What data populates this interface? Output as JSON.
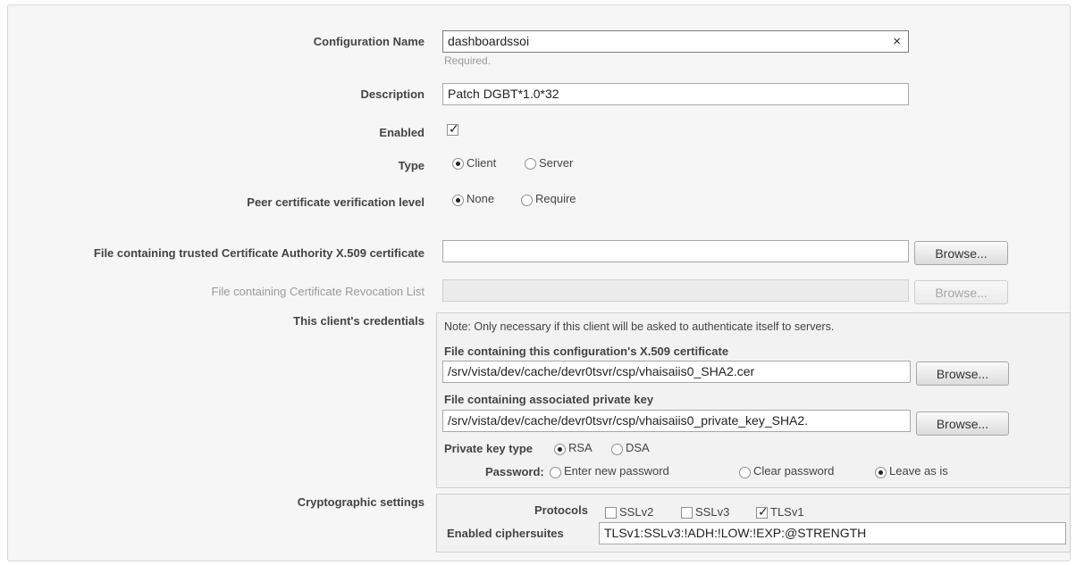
{
  "config_name": {
    "label": "Configuration Name",
    "value": "dashboardssoi",
    "hint": "Required.",
    "clear_icon": "×"
  },
  "description": {
    "label": "Description",
    "value": "Patch DGBT*1.0*32"
  },
  "enabled": {
    "label": "Enabled",
    "checked": true,
    "check_glyph": "✓"
  },
  "type": {
    "label": "Type",
    "options": [
      "Client",
      "Server"
    ],
    "selected": "Client"
  },
  "peer_verification": {
    "label": "Peer certificate verification level",
    "options": [
      "None",
      "Require"
    ],
    "selected": "None"
  },
  "trusted_ca": {
    "label": "File containing trusted Certificate Authority X.509 certificate",
    "value": "",
    "browse": "Browse..."
  },
  "crl": {
    "label": "File containing Certificate Revocation List",
    "value": "",
    "browse": "Browse..."
  },
  "credentials": {
    "label": "This client's credentials",
    "note": "Note: Only necessary if this client will be asked to authenticate itself to servers.",
    "cert_label": "File containing this configuration's X.509 certificate",
    "cert_value": "/srv/vista/dev/cache/devr0tsvr/csp/vhaisaiis0_SHA2.cer",
    "key_label": "File containing associated private key",
    "key_value": "/srv/vista/dev/cache/devr0tsvr/csp/vhaisaiis0_private_key_SHA2.",
    "browse": "Browse...",
    "key_type_label": "Private key type",
    "key_type_options": [
      "RSA",
      "DSA"
    ],
    "key_type_selected": "RSA",
    "password_label": "Password:",
    "password_options": [
      "Enter new password",
      "Clear password",
      "Leave as is"
    ],
    "password_selected": "Leave as is"
  },
  "crypto": {
    "label": "Cryptographic settings",
    "protocols_label": "Protocols",
    "protocols": [
      {
        "name": "SSLv2",
        "checked": false
      },
      {
        "name": "SSLv3",
        "checked": false
      },
      {
        "name": "TLSv1",
        "checked": true
      }
    ],
    "ciphersuites_label": "Enabled ciphersuites",
    "ciphersuites_value": "TLSv1:SSLv3:!ADH:!LOW:!EXP:@STRENGTH"
  },
  "colors": {
    "panel_bg": "#f6f6f6",
    "border": "#a9a9a9",
    "disabled_text": "#9a9a9a"
  }
}
